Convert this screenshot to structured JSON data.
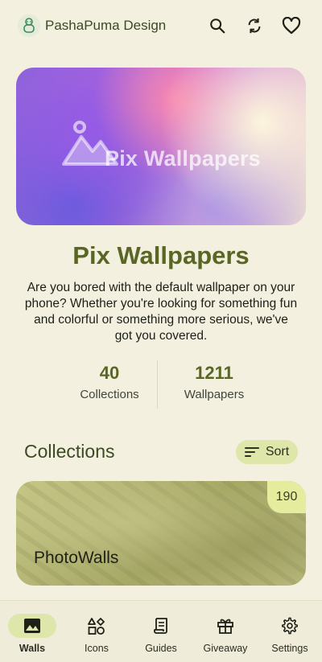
{
  "topbar": {
    "app_name": "PashaPuma Design",
    "icons": [
      "search-icon",
      "refresh-icon",
      "favorite-icon"
    ]
  },
  "hero": {
    "banner_text": "Pix Wallpapers"
  },
  "title": "Pix Wallpapers",
  "description": "Are you bored with the default wallpaper on your phone? Whether you're looking for something fun and colorful or something more serious, we've got you covered.",
  "stats": [
    {
      "value": "40",
      "label": "Collections"
    },
    {
      "value": "1211",
      "label": "Wallpapers"
    }
  ],
  "collections": {
    "title": "Collections",
    "sort_label": "Sort",
    "items": [
      {
        "name": "PhotoWalls",
        "count": "190"
      }
    ]
  },
  "bottom_nav": {
    "items": [
      {
        "label": "Walls",
        "icon": "image-icon",
        "active": true
      },
      {
        "label": "Icons",
        "icon": "shapes-icon",
        "active": false
      },
      {
        "label": "Guides",
        "icon": "scroll-icon",
        "active": false
      },
      {
        "label": "Giveaway",
        "icon": "gift-icon",
        "active": false
      },
      {
        "label": "Settings",
        "icon": "gear-icon",
        "active": false
      }
    ]
  },
  "colors": {
    "background": "#f3f0e0",
    "accent": "#5a6624",
    "chip": "#dfe6a9"
  }
}
